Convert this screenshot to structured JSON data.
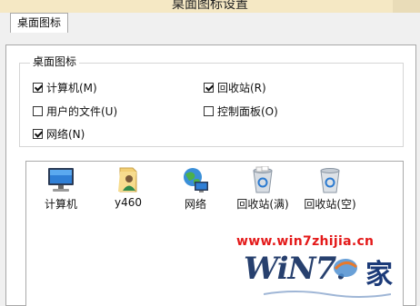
{
  "window": {
    "title": "桌面图标设置"
  },
  "tabs": [
    {
      "label": "桌面图标"
    }
  ],
  "group": {
    "legend": "桌面图标",
    "checkboxes": [
      {
        "label": "计算机(M)",
        "checked": true
      },
      {
        "label": "回收站(R)",
        "checked": true
      },
      {
        "label": "用户的文件(U)",
        "checked": false
      },
      {
        "label": "控制面板(O)",
        "checked": false
      },
      {
        "label": "网络(N)",
        "checked": true
      }
    ]
  },
  "icons": [
    {
      "label": "计算机",
      "icon": "computer-icon"
    },
    {
      "label": "y460",
      "icon": "user-folder-icon"
    },
    {
      "label": "网络",
      "icon": "network-icon"
    },
    {
      "label": "回收站(满)",
      "icon": "recycle-bin-full-icon"
    },
    {
      "label": "回收站(空)",
      "icon": "recycle-bin-empty-icon"
    }
  ],
  "watermark": {
    "url": "www.win7zhijia.cn",
    "logo_text": "WiN7.",
    "logo_char": "家"
  }
}
